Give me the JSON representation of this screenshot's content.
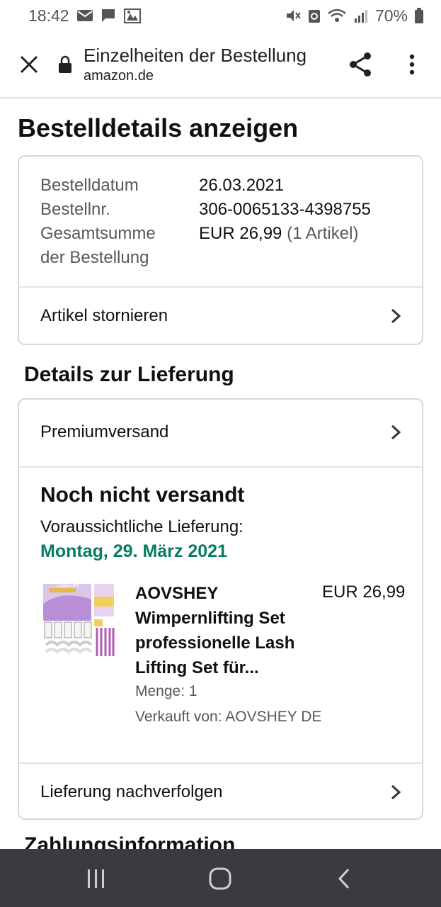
{
  "status_bar": {
    "time": "18:42",
    "battery_percent": "70%",
    "left_icons": [
      "mail-icon",
      "chat-icon",
      "gallery-icon"
    ],
    "right_icons": [
      "mute-icon",
      "recycle-icon",
      "wifi-icon",
      "signal-icon",
      "battery-icon"
    ]
  },
  "browser": {
    "page_title": "Einzelheiten der Bestellung",
    "domain": "amazon.de",
    "icons": [
      "close-icon",
      "lock-icon",
      "share-icon",
      "more-vert-icon"
    ]
  },
  "page": {
    "title": "Bestelldetails anzeigen"
  },
  "order": {
    "date_label": "Bestelldatum",
    "date_value": "26.03.2021",
    "number_label": "Bestellnr.",
    "number_value": "306-0065133-4398755",
    "total_label_line1": "Gesamtsumme",
    "total_label_line2": "der Bestellung",
    "total_value": "EUR 26,99",
    "total_count": "(1 Artikel)",
    "cancel_link": "Artikel stornieren"
  },
  "delivery": {
    "section_title": "Details zur Lieferung",
    "shipping_method": "Premiumversand",
    "status_title": "Noch nicht versandt",
    "estimate_label": "Voraussichtliche Lieferung:",
    "estimate_date": "Montag, 29. März 2021",
    "item": {
      "name": "AOVSHEY Wimpernlifting Set professionelle Lash Lifting Set für...",
      "price": "EUR 26,99",
      "quantity": "Menge: 1",
      "seller": "Verkauft von: AOVSHEY DE",
      "image_label": "LASH LIFT"
    },
    "track_link": "Lieferung nachverfolgen"
  },
  "next_section": {
    "title": "Zahlungsinformation"
  },
  "navbar": {
    "buttons": [
      "recent-apps-icon",
      "home-icon",
      "back-icon"
    ]
  },
  "colors": {
    "accent_green": "#067d62",
    "border": "#d5d9d9",
    "muted_text": "#565959",
    "navbar": "#3a3a3f"
  }
}
